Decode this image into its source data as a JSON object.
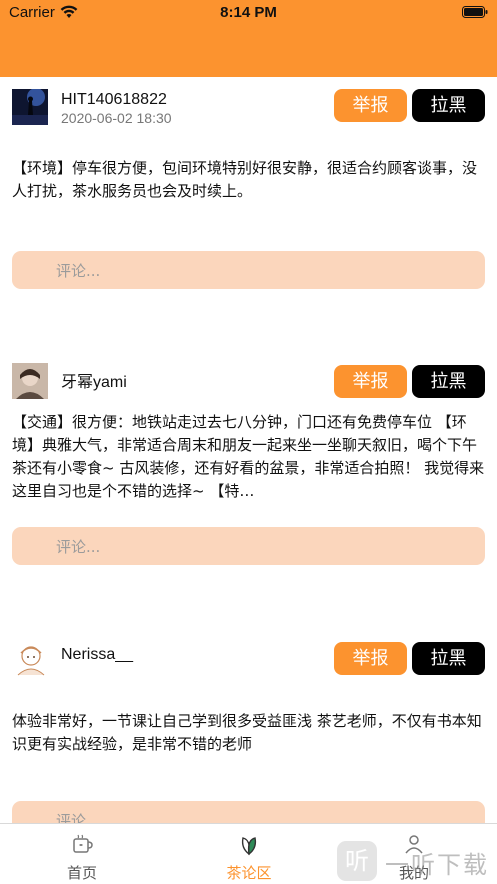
{
  "status_bar": {
    "carrier": "Carrier",
    "time": "8:14 PM"
  },
  "posts": [
    {
      "username": "HIT140618822",
      "date": "2020-06-02 18:30",
      "report_label": "举报",
      "block_label": "拉黑",
      "text": "【环境】停车很方便，包间环境特别好很安静，很适合约顾客谈事，没人打扰，茶水服务员也会及时续上。",
      "comment_placeholder": "评论..."
    },
    {
      "username": "牙幂yami",
      "date": "",
      "report_label": "举报",
      "block_label": "拉黑",
      "text": "【交通】很方便：地铁站走过去七八分钟，门口还有免费停车位 【环境】典雅大气，非常适合周末和朋友一起来坐一坐聊天叙旧，喝个下午茶还有小零食~ 古风装修，还有好看的盆景，非常适合拍照！ 我觉得来这里自习也是个不错的选择~ 【特…",
      "comment_placeholder": "评论..."
    },
    {
      "username": "Nerissa__",
      "date": "",
      "report_label": "举报",
      "block_label": "拉黑",
      "text": "体验非常好，一节课让自己学到很多受益匪浅 茶艺老师，不仅有书本知识更有实战经验，是非常不错的老师",
      "comment_placeholder": "评论..."
    }
  ],
  "tabbar": {
    "tabs": [
      {
        "label": "首页",
        "icon": "home-cup-icon",
        "active": false
      },
      {
        "label": "茶论区",
        "icon": "tea-leaf-icon",
        "active": true
      },
      {
        "label": "我的",
        "icon": "profile-icon",
        "active": false
      }
    ]
  },
  "watermark": {
    "text": "一听下载"
  },
  "colors": {
    "accent": "#fc932f",
    "comment_bg": "#fbd6bc",
    "block_bg": "#000000"
  }
}
